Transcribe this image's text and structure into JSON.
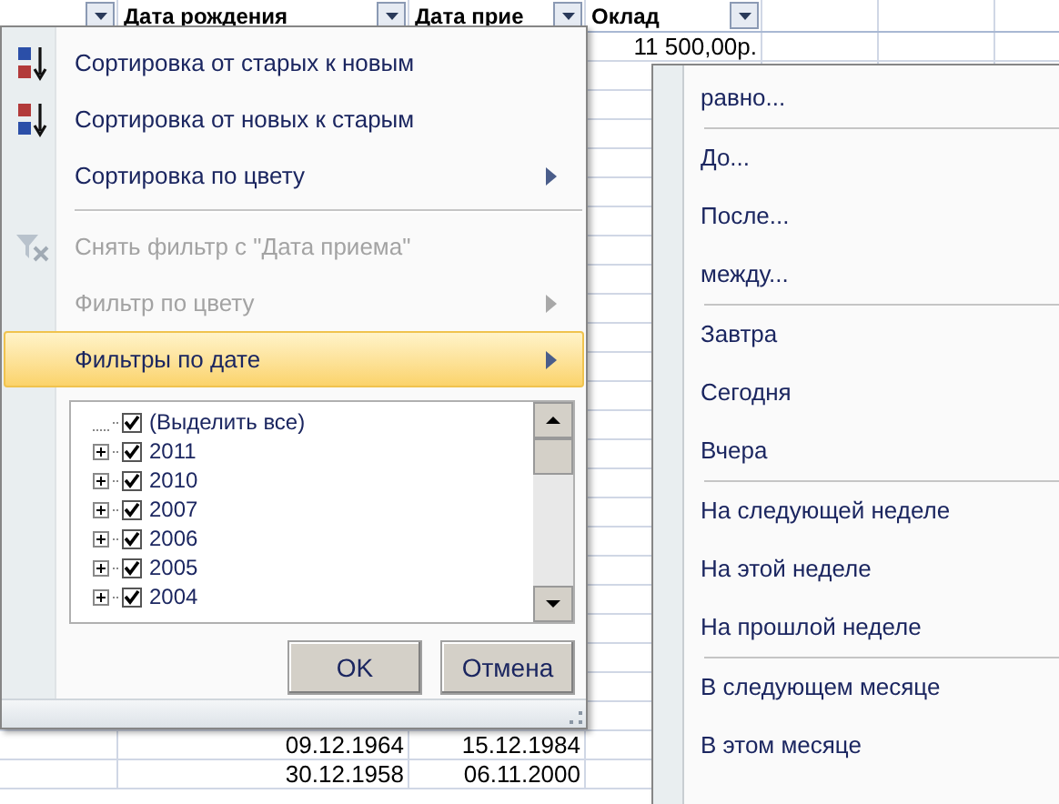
{
  "sheet": {
    "columns": [
      {
        "filter": true
      },
      {
        "label": "Дата рождения",
        "filter": true
      },
      {
        "label": "Дата прие",
        "filter": true
      },
      {
        "label": "Оклад",
        "filter": true
      },
      {
        "filter": false
      },
      {
        "filter": false
      },
      {
        "filter": false
      }
    ],
    "top_rows": [
      {
        "cells": [
          "",
          "",
          "",
          "11 500,00р.",
          "",
          "",
          ""
        ]
      }
    ],
    "bottom_rows": [
      {
        "cells": [
          "",
          "09.12.1964",
          "15.12.1984",
          "",
          "",
          "",
          ""
        ]
      },
      {
        "cells": [
          "",
          "30.12.1958",
          "06.11.2000",
          "",
          "",
          "",
          ""
        ]
      }
    ]
  },
  "filter_menu": {
    "items": [
      {
        "kind": "item",
        "label": "Сортировка от старых к новым",
        "disabled": false,
        "selected": false,
        "submenu": false
      },
      {
        "kind": "item",
        "label": "Сортировка от новых к старым",
        "disabled": false,
        "selected": false,
        "submenu": false
      },
      {
        "kind": "item",
        "label": "Сортировка по цвету",
        "disabled": false,
        "selected": false,
        "submenu": true
      },
      {
        "kind": "separator"
      },
      {
        "kind": "item",
        "label": "Снять фильтр с \"Дата приема\"",
        "disabled": true,
        "selected": false,
        "submenu": false
      },
      {
        "kind": "item",
        "label": "Фильтр по цвету",
        "disabled": true,
        "selected": false,
        "submenu": true
      },
      {
        "kind": "item",
        "label": "Фильтры по дате",
        "disabled": false,
        "selected": true,
        "submenu": true
      }
    ],
    "tree": [
      {
        "label": "(Выделить все)",
        "checked": true,
        "expandable": false
      },
      {
        "label": "2011",
        "checked": true,
        "expandable": true
      },
      {
        "label": "2010",
        "checked": true,
        "expandable": true
      },
      {
        "label": "2007",
        "checked": true,
        "expandable": true
      },
      {
        "label": "2006",
        "checked": true,
        "expandable": true
      },
      {
        "label": "2005",
        "checked": true,
        "expandable": true
      },
      {
        "label": "2004",
        "checked": true,
        "expandable": true
      }
    ],
    "buttons": [
      "OK",
      "Отмена"
    ]
  },
  "date_submenu": {
    "groups": [
      [
        "равно..."
      ],
      [
        "До...",
        "После...",
        "между..."
      ],
      [
        "Завтра",
        "Сегодня",
        "Вчера"
      ],
      [
        "На следующей неделе",
        "На этой неделе",
        "На прошлой неделе"
      ],
      [
        "В следующем месяце",
        "В этом месяце"
      ]
    ]
  }
}
